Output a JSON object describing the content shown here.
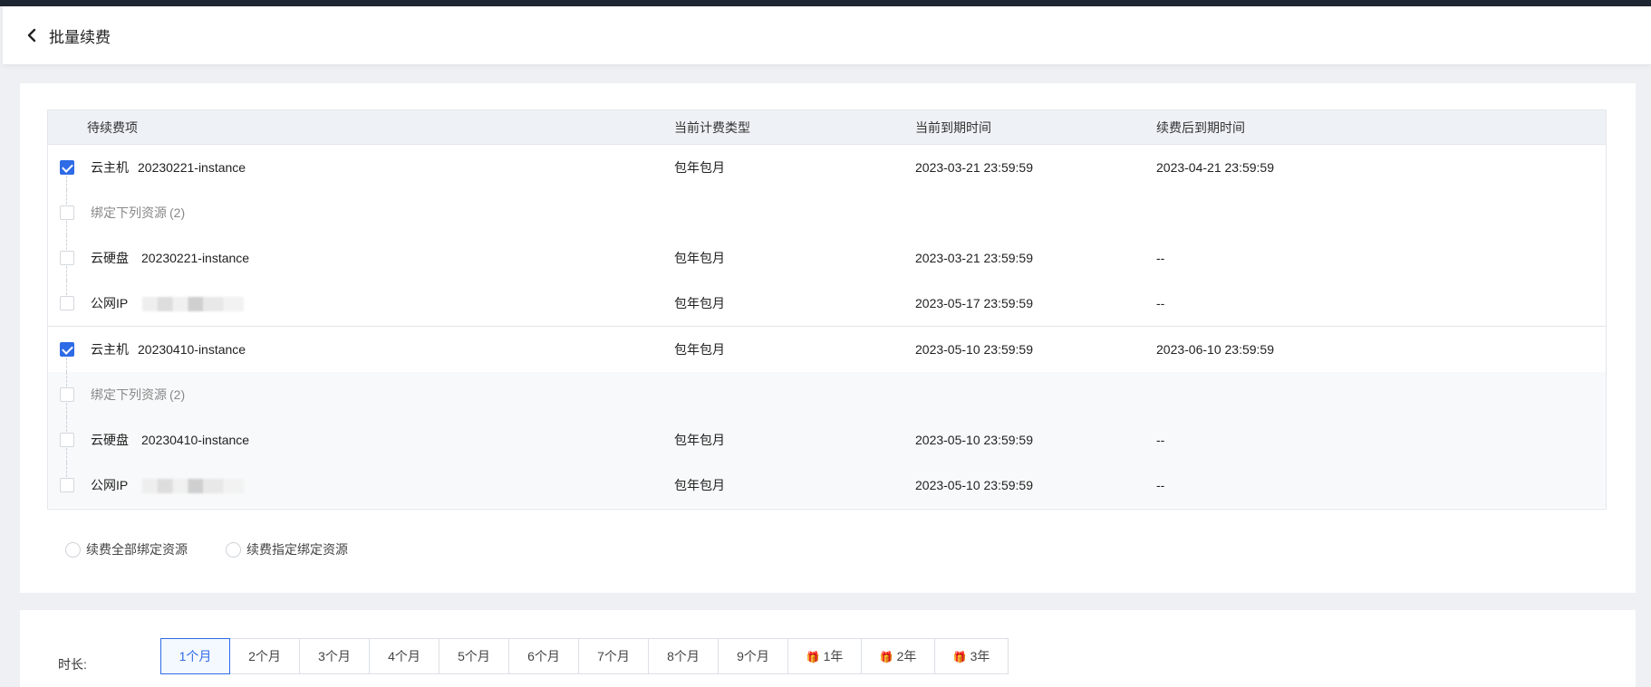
{
  "header": {
    "title": "批量续费"
  },
  "table": {
    "columns": [
      "待续费项",
      "当前计费类型",
      "当前到期时间",
      "续费后到期时间"
    ],
    "groups": [
      {
        "instance": {
          "type": "云主机",
          "name": "20230221-instance",
          "billing": "包年包月",
          "expire": "2023-03-21 23:59:59",
          "renewed_expire": "2023-04-21 23:59:59",
          "checked": true
        },
        "bind_label": "绑定下列资源",
        "bind_count": "(2)",
        "resources": [
          {
            "type": "云硬盘",
            "name": "20230221-instance",
            "billing": "包年包月",
            "expire": "2023-03-21 23:59:59",
            "renewed_expire": "--"
          },
          {
            "type": "公网IP",
            "name": "",
            "billing": "包年包月",
            "expire": "2023-05-17 23:59:59",
            "renewed_expire": "--"
          }
        ]
      },
      {
        "instance": {
          "type": "云主机",
          "name": "20230410-instance",
          "billing": "包年包月",
          "expire": "2023-05-10 23:59:59",
          "renewed_expire": "2023-06-10 23:59:59",
          "checked": true
        },
        "bind_label": "绑定下列资源",
        "bind_count": "(2)",
        "resources": [
          {
            "type": "云硬盘",
            "name": "20230410-instance",
            "billing": "包年包月",
            "expire": "2023-05-10 23:59:59",
            "renewed_expire": "--"
          },
          {
            "type": "公网IP",
            "name": "",
            "billing": "包年包月",
            "expire": "2023-05-10 23:59:59",
            "renewed_expire": "--"
          }
        ]
      }
    ]
  },
  "renew_options": [
    "续费全部绑定资源",
    "续费指定绑定资源"
  ],
  "duration": {
    "label": "时长:",
    "options": [
      "1个月",
      "2个月",
      "3个月",
      "4个月",
      "5个月",
      "6个月",
      "7个月",
      "8个月",
      "9个月",
      "1年",
      "2年",
      "3年"
    ],
    "selected": "1个月"
  },
  "colors": {
    "accent": "#2e6be6",
    "topbar": "#1f2633"
  }
}
